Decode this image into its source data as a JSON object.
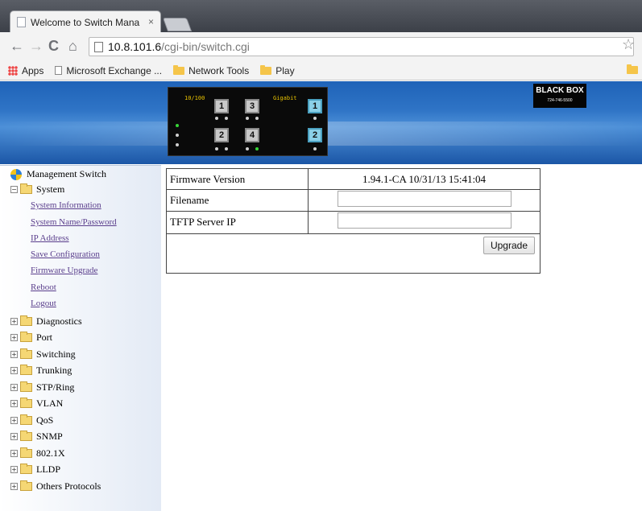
{
  "browser": {
    "tab_title": "Welcome to Switch Mana",
    "tab_close": "×",
    "url_host": "10.8.101.6",
    "url_path": "/cgi-bin/switch.cgi",
    "nav_back": "←",
    "nav_forward": "→",
    "nav_reload": "C",
    "nav_home": "⌂",
    "star": "☆",
    "bookmarks": [
      "Apps",
      "Microsoft Exchange ...",
      "Network Tools",
      "Play"
    ]
  },
  "header": {
    "panel_label_fast": "10/100",
    "panel_label_gig": "Gigabit",
    "ports_fast": [
      "1",
      "3",
      "2",
      "4"
    ],
    "ports_gig": [
      "1",
      "2"
    ],
    "logo_text": "BLACK BOX",
    "logo_phone": "724-746-5500"
  },
  "tree": {
    "root": "Management Switch",
    "system": "System",
    "system_items": [
      "System Information",
      "System Name/Password",
      "IP Address",
      "Save Configuration",
      "Firmware Upgrade",
      "Reboot",
      "Logout"
    ],
    "folders": [
      "Diagnostics",
      "Port",
      "Switching",
      "Trunking",
      "STP/Ring",
      "VLAN",
      "QoS",
      "SNMP",
      "802.1X",
      "LLDP",
      "Others Protocols"
    ]
  },
  "form": {
    "fw_label": "Firmware Version",
    "fw_value": "1.94.1-CA 10/31/13 15:41:04",
    "filename_label": "Filename",
    "filename_value": "",
    "tftp_label": "TFTP Server IP",
    "tftp_value": "",
    "upgrade_label": "Upgrade"
  }
}
